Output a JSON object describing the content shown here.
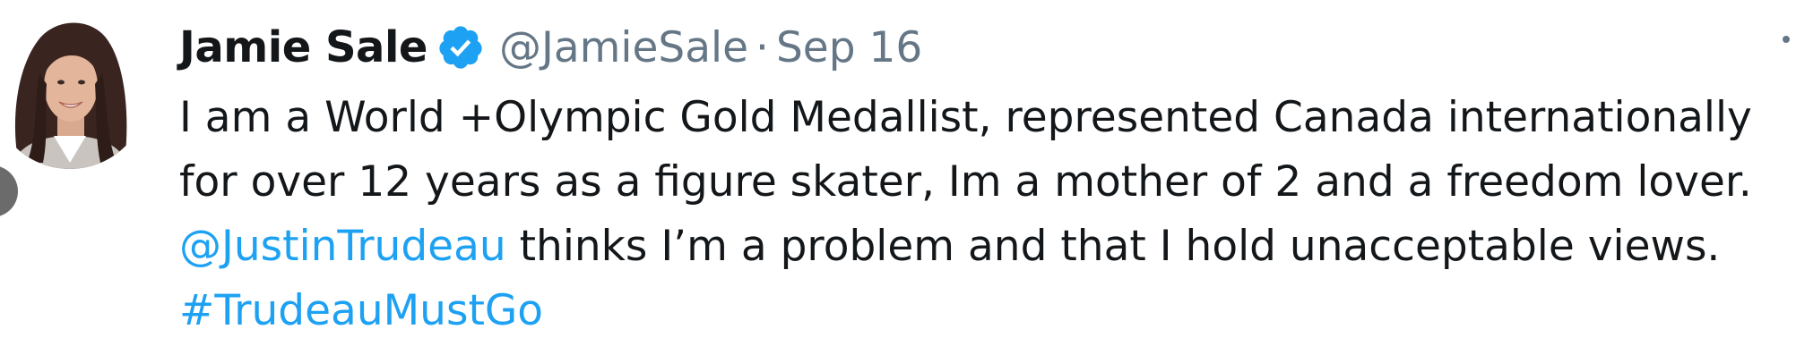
{
  "tweet": {
    "author": {
      "display_name": "Jamie Sale",
      "handle": "@JamieSale",
      "verified": true,
      "verified_icon": "verified-badge-icon",
      "avatar_icon": "profile-photo"
    },
    "separator": "·",
    "date": "Sep 16",
    "text": {
      "line1": "I am a World +Olympic Gold Medallist, represented Canada internationally",
      "line2": "for over 12 years as a figure skater, Im a mother of 2 and a freedom lover.",
      "line3_mention": "@JustinTrudeau",
      "line3_rest": " thinks I’m a problem and that I hold unacceptable views.",
      "line4_hashtag": "#TrudeauMustGo"
    }
  },
  "colors": {
    "link": "#1da1f2",
    "muted": "#657786",
    "text": "#14171a",
    "verified": "#1da1f2"
  }
}
